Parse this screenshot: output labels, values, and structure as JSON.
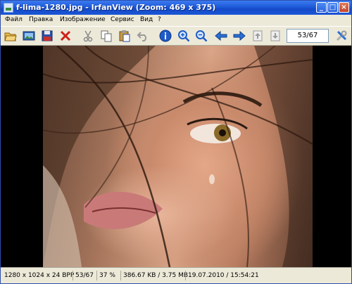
{
  "window": {
    "title": "f-lima-1280.jpg - IrfanView (Zoom: 469 x 375)",
    "minimize_glyph": "_",
    "maximize_glyph": "□",
    "close_glyph": "×"
  },
  "menu": {
    "items": [
      "Файл",
      "Правка",
      "Изображение",
      "Сервис",
      "Вид",
      "?"
    ]
  },
  "toolbar": {
    "icons": [
      "open-folder-icon",
      "slideshow-icon",
      "save-icon",
      "delete-icon",
      "cut-icon",
      "copy-icon",
      "paste-icon",
      "undo-icon",
      "info-icon",
      "zoom-in-icon",
      "zoom-out-icon",
      "previous-arrow-icon",
      "next-arrow-icon",
      "first-page-icon",
      "last-page-icon",
      "settings-icon"
    ],
    "page_counter": "53/67"
  },
  "status": {
    "dimensions": "1280 x 1024 x 24 BPP",
    "index": "53/67",
    "zoom": "37 %",
    "filesize": "386.67 KB / 3.75 MB",
    "datetime": "19.07.2010 / 15:54:21"
  },
  "colors": {
    "title_blue": "#1e5ad8",
    "chrome": "#ece9d8",
    "viewport_bg": "#000000"
  }
}
